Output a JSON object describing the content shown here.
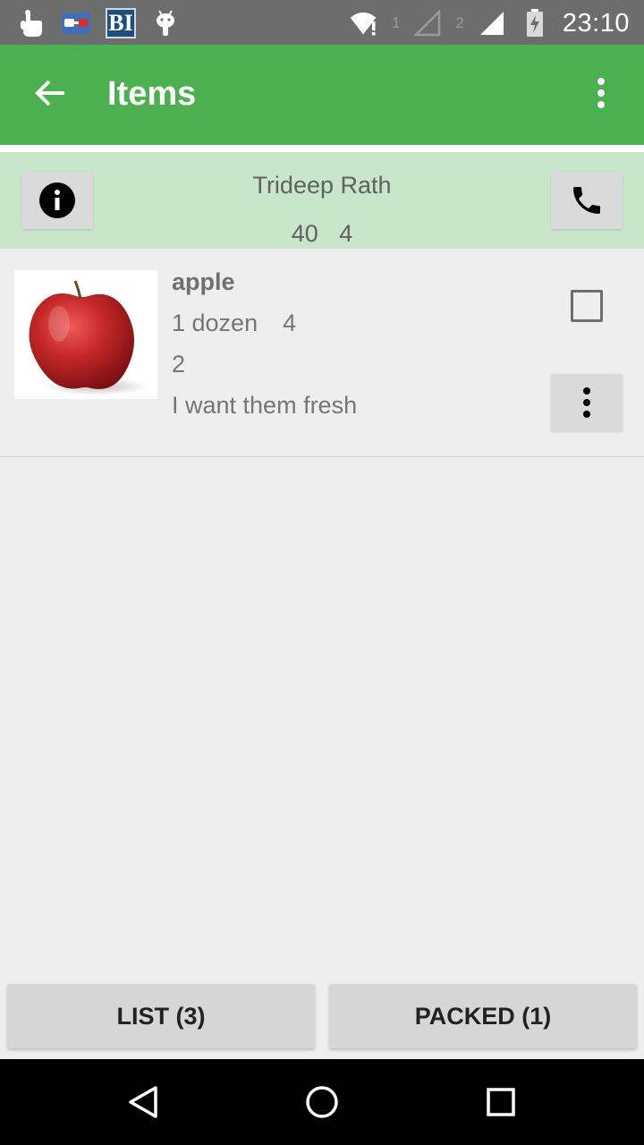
{
  "status_bar": {
    "time": "23:10",
    "sim1_label": "1",
    "sim2_label": "2",
    "icons": [
      "touch-icon",
      "glasses-icon",
      "bi-app-icon",
      "android-debug-icon",
      "wifi-icon",
      "signal-sim1-icon",
      "signal-sim2-icon",
      "battery-charging-icon"
    ],
    "bi_label": "BI"
  },
  "app_bar": {
    "title": "Items",
    "back_icon": "arrow-back-icon",
    "menu_icon": "more-vert-icon",
    "color": "#4caf50"
  },
  "customer": {
    "name": "Trideep Rath",
    "stat_1": "40",
    "stat_2": "4",
    "info_icon": "info-icon",
    "call_icon": "phone-icon",
    "background": "#c8e6c9"
  },
  "items": [
    {
      "name": "apple",
      "unit": "1 dozen",
      "quantity": "4",
      "count": "2",
      "note": "I want them fresh",
      "checked": false,
      "image": "apple-image"
    }
  ],
  "bottom_buttons": {
    "list_label": "LIST (3)",
    "packed_label": "PACKED (1)"
  },
  "nav_bar": {
    "back_icon": "nav-back-icon",
    "home_icon": "nav-home-icon",
    "recents_icon": "nav-recents-icon"
  }
}
